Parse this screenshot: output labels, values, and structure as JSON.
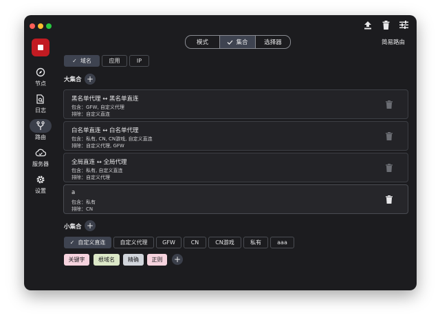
{
  "segmented": {
    "items": [
      "模式",
      "集合",
      "选择器"
    ],
    "selected_index": 1
  },
  "header": {
    "title": "简易路由"
  },
  "sidebar": {
    "items": [
      {
        "label": "节点",
        "icon": "compass-icon"
      },
      {
        "label": "日志",
        "icon": "document-search-icon"
      },
      {
        "label": "路由",
        "icon": "fork-icon",
        "active": true
      },
      {
        "label": "服务器",
        "icon": "cloud-icon"
      },
      {
        "label": "设置",
        "icon": "gear-icon"
      }
    ]
  },
  "type_tabs": [
    {
      "label": "域名",
      "selected": true
    },
    {
      "label": "应用",
      "selected": false
    },
    {
      "label": "IP",
      "selected": false
    }
  ],
  "big_sets": {
    "title": "大集合",
    "cards": [
      {
        "title": "黑名单代理 ↔ 黑名单直连",
        "include": "包含：GFW, 自定义代理",
        "exclude": "排除：自定义直连"
      },
      {
        "title": "白名单直连 ↔ 白名单代理",
        "include": "包含：私有, CN, CN游戏, 自定义直连",
        "exclude": "排除：自定义代理, GFW"
      },
      {
        "title": "全局直连 ↔ 全局代理",
        "include": "包含：私有, 自定义直连",
        "exclude": "排除：自定义代理"
      },
      {
        "title": "a",
        "include": "包含：私有",
        "exclude": "排除：CN",
        "selected": true
      }
    ]
  },
  "small_sets": {
    "title": "小集合",
    "chips": [
      {
        "label": "自定义直连",
        "selected": true
      },
      {
        "label": "自定义代理",
        "selected": false
      },
      {
        "label": "GFW",
        "selected": false
      },
      {
        "label": "CN",
        "selected": false
      },
      {
        "label": "CN游戏",
        "selected": false
      },
      {
        "label": "私有",
        "selected": false
      },
      {
        "label": "aaa",
        "selected": false
      }
    ]
  },
  "match_tags": [
    {
      "label": "关键字",
      "color": "#f6d3de"
    },
    {
      "label": "根域名",
      "color": "#dce8c8"
    },
    {
      "label": "精确",
      "color": "#d2d6dc"
    },
    {
      "label": "正则",
      "color": "#f6d3de"
    }
  ],
  "colors": {
    "accent_red": "#c21b22",
    "window_bg": "#1c1c1f",
    "selected_bg": "#3e4350"
  }
}
